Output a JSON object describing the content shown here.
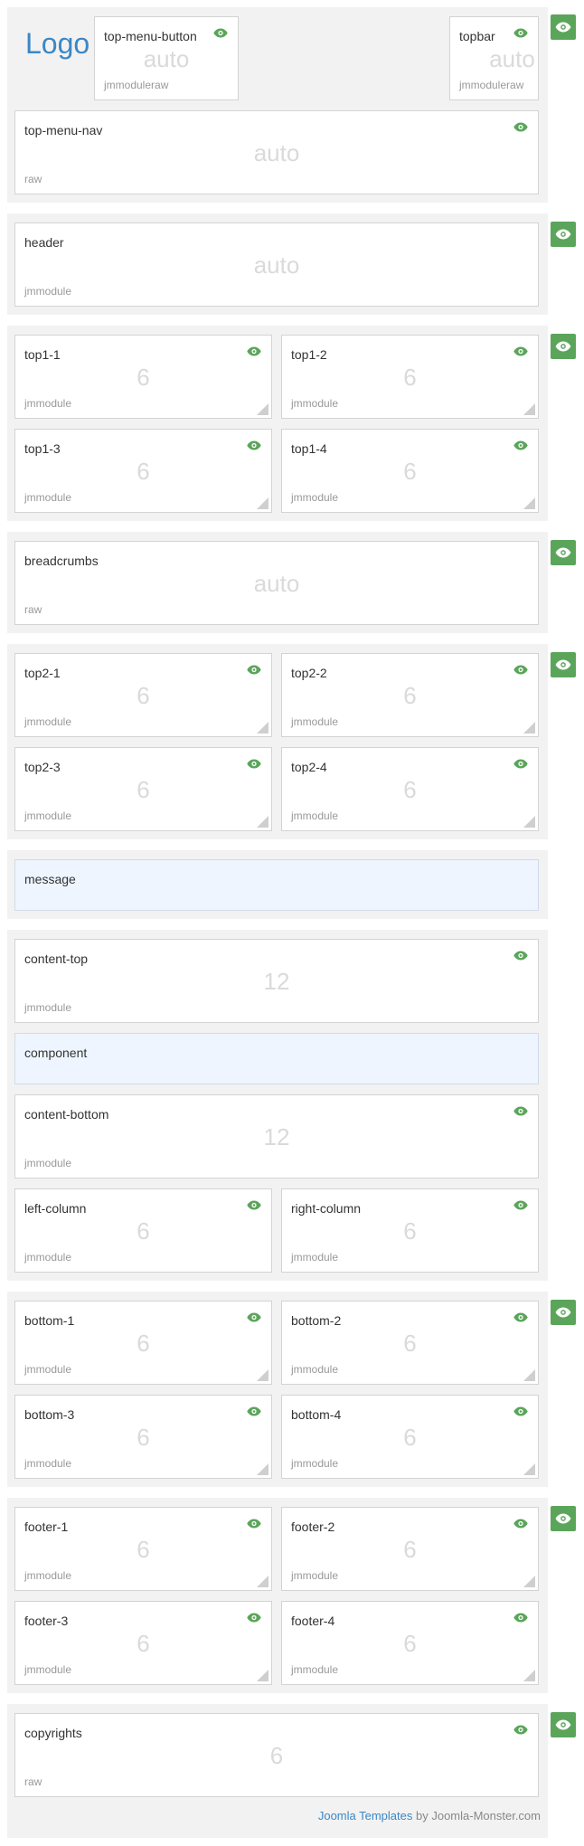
{
  "colors": {
    "accent_green": "#5ba55b",
    "link_blue": "#3b87c5",
    "section_bg": "#f2f2f2",
    "blue_box_bg": "#eef5ff"
  },
  "logo_text": "Logo",
  "side_toggle_icon": "eye-icon",
  "header_section": {
    "top_menu_button": {
      "name": "top-menu-button",
      "size": "auto",
      "type": "jmmoduleraw"
    },
    "topbar": {
      "name": "topbar",
      "size": "auto",
      "type": "jmmoduleraw"
    },
    "top_menu_nav": {
      "name": "top-menu-nav",
      "size": "auto",
      "type": "raw"
    }
  },
  "header": {
    "name": "header",
    "size": "auto",
    "type": "jmmodule"
  },
  "top1": [
    {
      "name": "top1-1",
      "size": "6",
      "type": "jmmodule"
    },
    {
      "name": "top1-2",
      "size": "6",
      "type": "jmmodule"
    },
    {
      "name": "top1-3",
      "size": "6",
      "type": "jmmodule"
    },
    {
      "name": "top1-4",
      "size": "6",
      "type": "jmmodule"
    }
  ],
  "breadcrumbs": {
    "name": "breadcrumbs",
    "size": "auto",
    "type": "raw"
  },
  "top2": [
    {
      "name": "top2-1",
      "size": "6",
      "type": "jmmodule"
    },
    {
      "name": "top2-2",
      "size": "6",
      "type": "jmmodule"
    },
    {
      "name": "top2-3",
      "size": "6",
      "type": "jmmodule"
    },
    {
      "name": "top2-4",
      "size": "6",
      "type": "jmmodule"
    }
  ],
  "message": {
    "name": "message"
  },
  "content": {
    "content_top": {
      "name": "content-top",
      "size": "12",
      "type": "jmmodule"
    },
    "component": {
      "name": "component"
    },
    "content_bottom": {
      "name": "content-bottom",
      "size": "12",
      "type": "jmmodule"
    },
    "left_column": {
      "name": "left-column",
      "size": "6",
      "type": "jmmodule"
    },
    "right_column": {
      "name": "right-column",
      "size": "6",
      "type": "jmmodule"
    }
  },
  "bottom": [
    {
      "name": "bottom-1",
      "size": "6",
      "type": "jmmodule"
    },
    {
      "name": "bottom-2",
      "size": "6",
      "type": "jmmodule"
    },
    {
      "name": "bottom-3",
      "size": "6",
      "type": "jmmodule"
    },
    {
      "name": "bottom-4",
      "size": "6",
      "type": "jmmodule"
    }
  ],
  "footer": [
    {
      "name": "footer-1",
      "size": "6",
      "type": "jmmodule"
    },
    {
      "name": "footer-2",
      "size": "6",
      "type": "jmmodule"
    },
    {
      "name": "footer-3",
      "size": "6",
      "type": "jmmodule"
    },
    {
      "name": "footer-4",
      "size": "6",
      "type": "jmmodule"
    }
  ],
  "copyrights": {
    "name": "copyrights",
    "size": "6",
    "type": "raw"
  },
  "credit": {
    "link_text": "Joomla Templates",
    "by_text": " by Joomla-Monster.com"
  }
}
